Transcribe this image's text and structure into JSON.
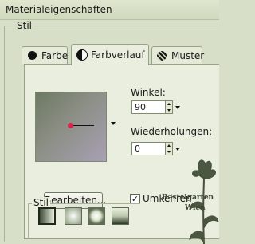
{
  "window": {
    "title": "Materialeigenschaften"
  },
  "section": {
    "label": "Stil"
  },
  "tabs": [
    {
      "label": "Farbe",
      "active": false
    },
    {
      "label": "Farbverlauf",
      "active": true
    },
    {
      "label": "Muster",
      "active": false
    }
  ],
  "gradient": {
    "colors": [
      "#6d7a62",
      "#8c8f86",
      "#a8a0b4"
    ],
    "angle_label": "Winkel:",
    "angle_value": "90",
    "repeats_label": "Wiederholungen:",
    "repeats_value": "0",
    "edit_button": "Bearbeiten...",
    "invert_label": "Umkehren",
    "invert_checked": true,
    "style_label": "Stil",
    "styles": [
      "linear",
      "radial",
      "rectangular",
      "sunburst"
    ]
  },
  "watermark": {
    "line1": "Bastelgarten",
    "line2": "Wien"
  }
}
